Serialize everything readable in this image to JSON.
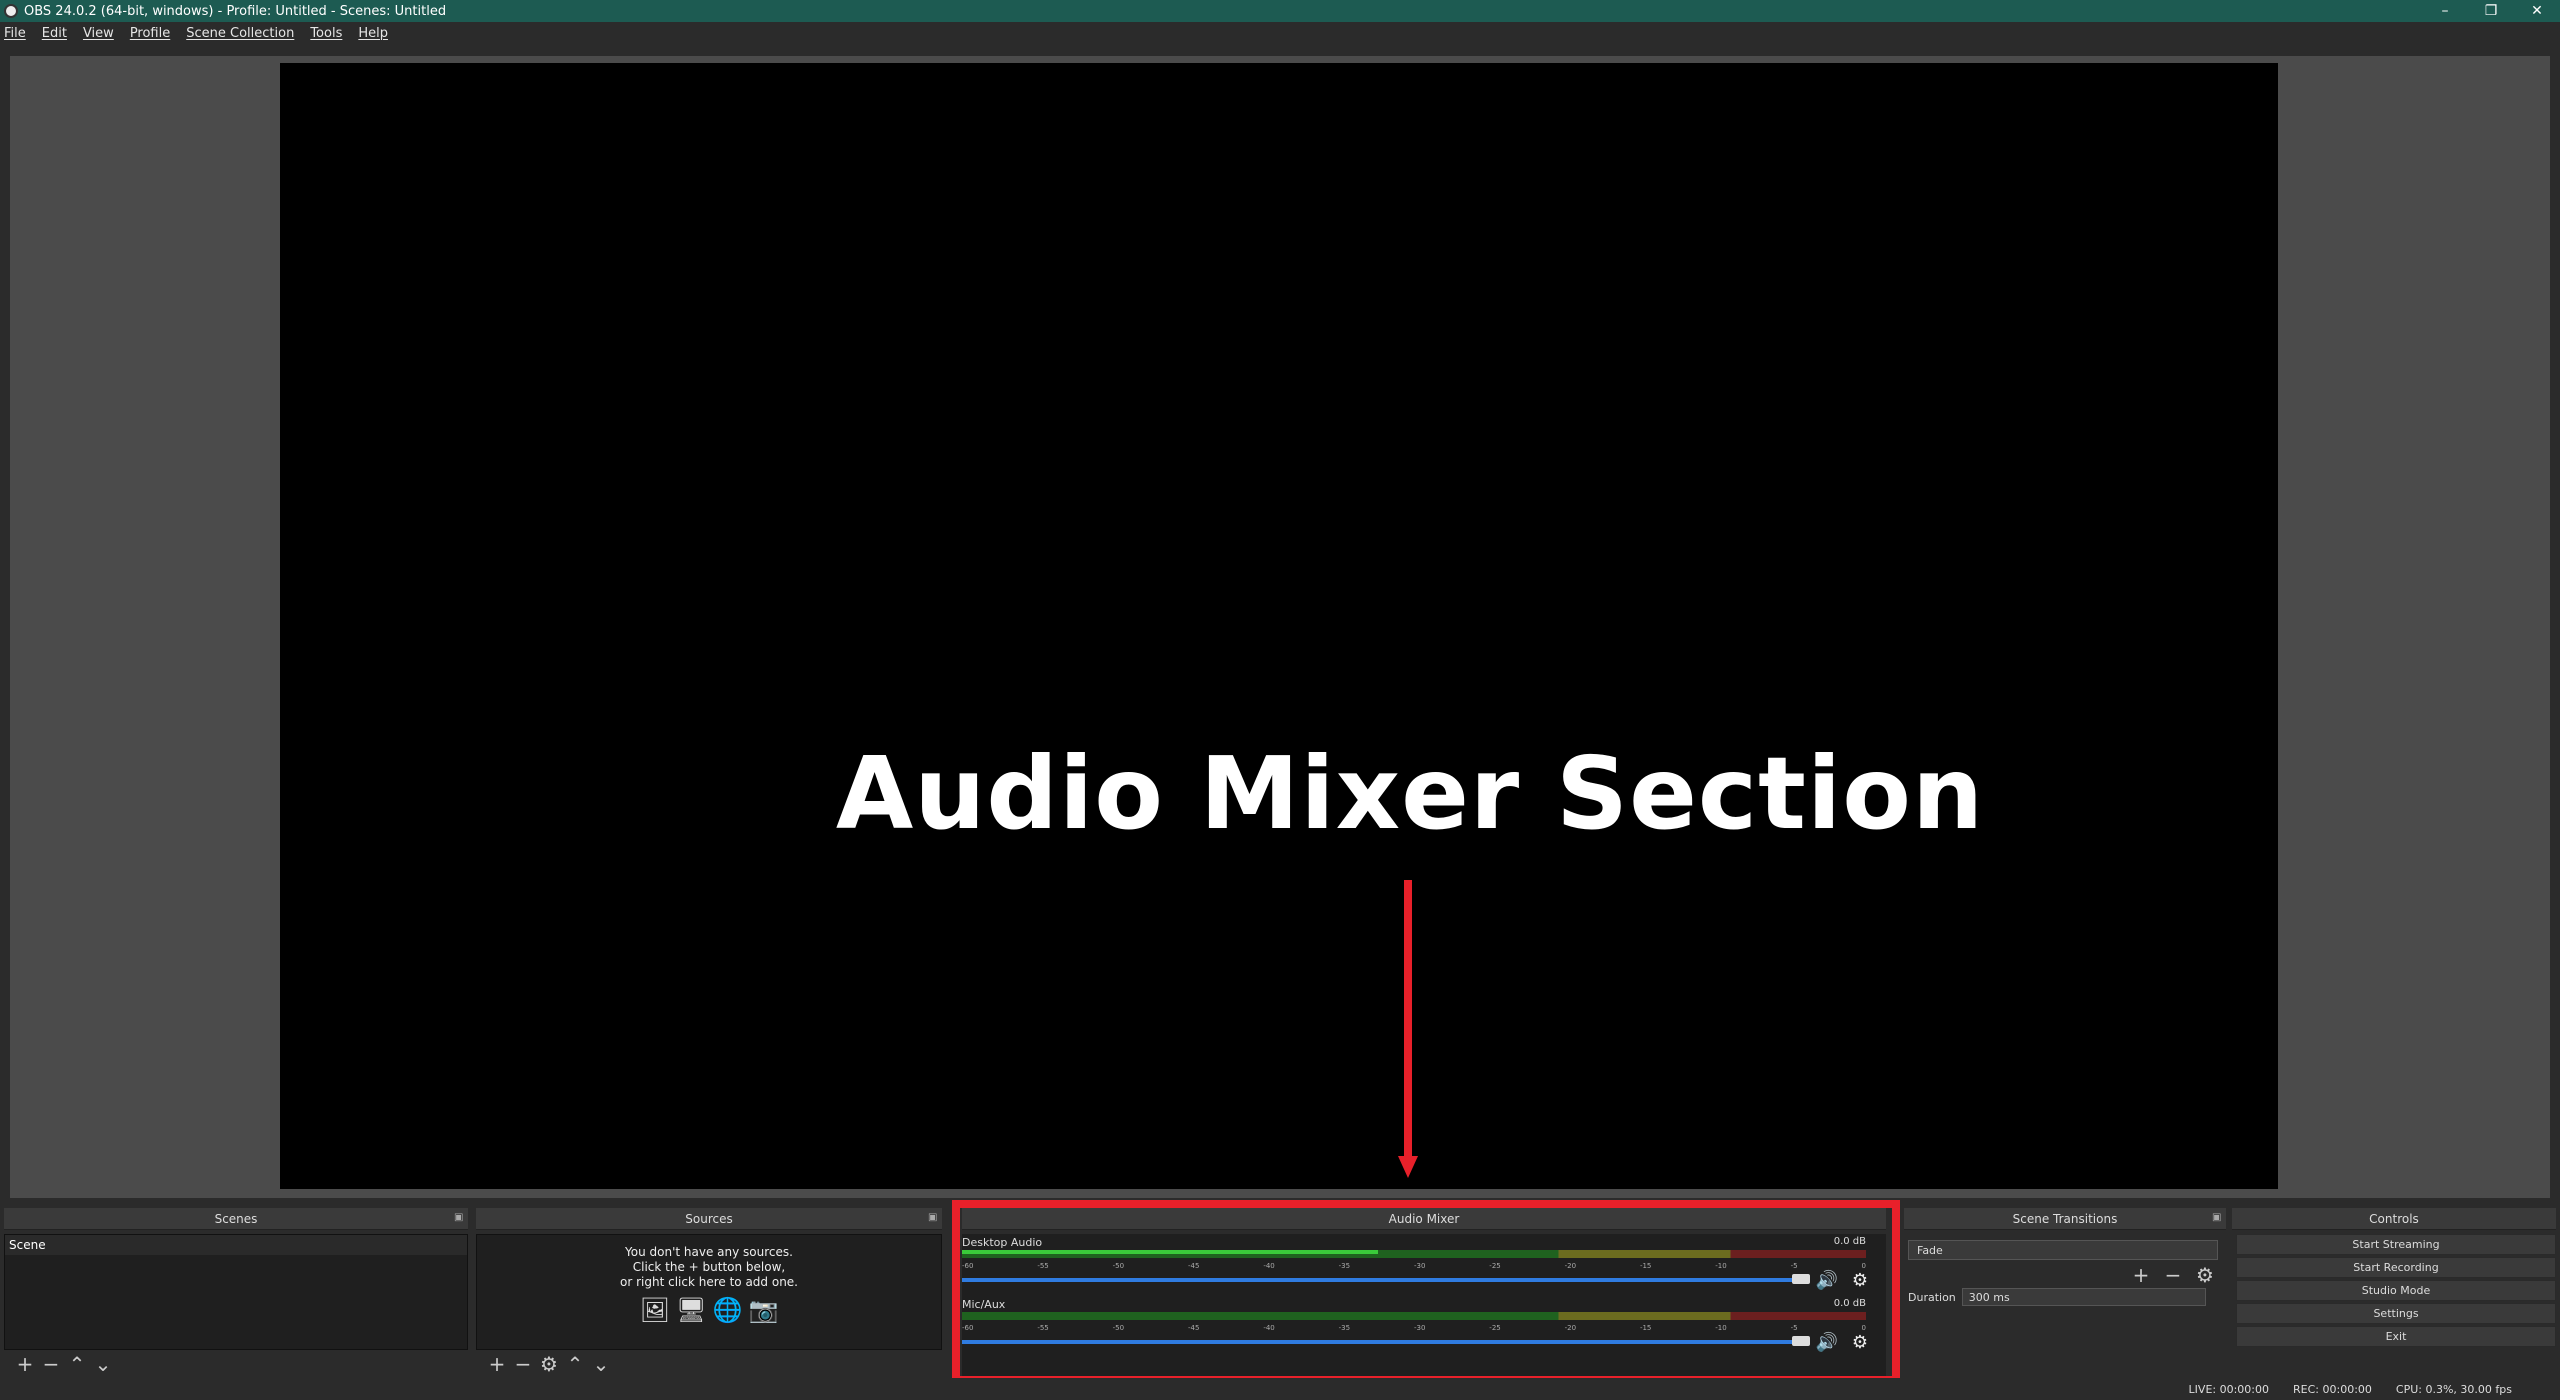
{
  "window": {
    "title": "OBS 24.0.2 (64-bit, windows) - Profile: Untitled - Scenes: Untitled",
    "minimize": "–",
    "restore": "❐",
    "close": "✕"
  },
  "menu": [
    "File",
    "Edit",
    "View",
    "Profile",
    "Scene Collection",
    "Tools",
    "Help"
  ],
  "annotation": {
    "text": "Audio Mixer Section",
    "color": "#e8202a"
  },
  "docks": {
    "scenes": {
      "title": "Scenes",
      "items": [
        "Scene"
      ]
    },
    "sources": {
      "title": "Sources",
      "empty_line1": "You don't have any sources.",
      "empty_line2": "Click the + button below,",
      "empty_line3": "or right click here to add one."
    },
    "mixer": {
      "title": "Audio Mixer",
      "channels": [
        {
          "name": "Desktop Audio",
          "db": "0.0 dB",
          "level": 0.46
        },
        {
          "name": "Mic/Aux",
          "db": "0.0 dB",
          "level": 0.0
        }
      ],
      "ticks": [
        "-60",
        "-55",
        "-50",
        "-45",
        "-40",
        "-35",
        "-30",
        "-25",
        "-20",
        "-15",
        "-10",
        "-5",
        "0"
      ]
    },
    "transitions": {
      "title": "Scene Transitions",
      "selected": "Fade",
      "duration_label": "Duration",
      "duration_value": "300 ms"
    },
    "controls": {
      "title": "Controls",
      "buttons": [
        "Start Streaming",
        "Start Recording",
        "Studio Mode",
        "Settings",
        "Exit"
      ]
    }
  },
  "status": {
    "live": "LIVE: 00:00:00",
    "rec": "REC: 00:00:00",
    "cpu": "CPU: 0.3%, 30.00 fps"
  }
}
